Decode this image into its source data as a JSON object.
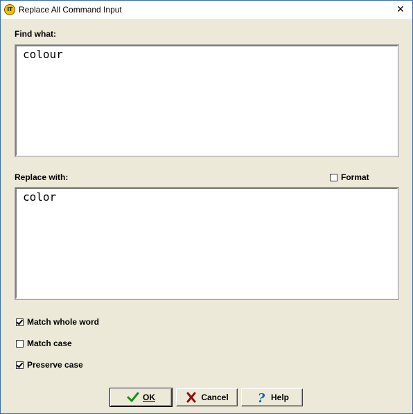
{
  "window": {
    "title": "Replace All Command Input",
    "app_icon_text": "IT",
    "close_glyph": "✕"
  },
  "find": {
    "label": "Find what:",
    "value": "colour"
  },
  "replace": {
    "label": "Replace with:",
    "value": "color"
  },
  "format": {
    "label": "Format",
    "checked": false
  },
  "options": [
    {
      "label": "Match whole word",
      "checked": true
    },
    {
      "label": "Match case",
      "checked": false
    },
    {
      "label": "Preserve case",
      "checked": true
    }
  ],
  "buttons": {
    "ok": {
      "label": "OK",
      "icon": "checkmark-icon",
      "color": "#1a8c1a"
    },
    "cancel": {
      "label": "Cancel",
      "icon": "x-mark-icon",
      "color": "#8b1010"
    },
    "help": {
      "label": "Help",
      "icon": "question-mark-icon",
      "color": "#1a5fb4"
    }
  }
}
